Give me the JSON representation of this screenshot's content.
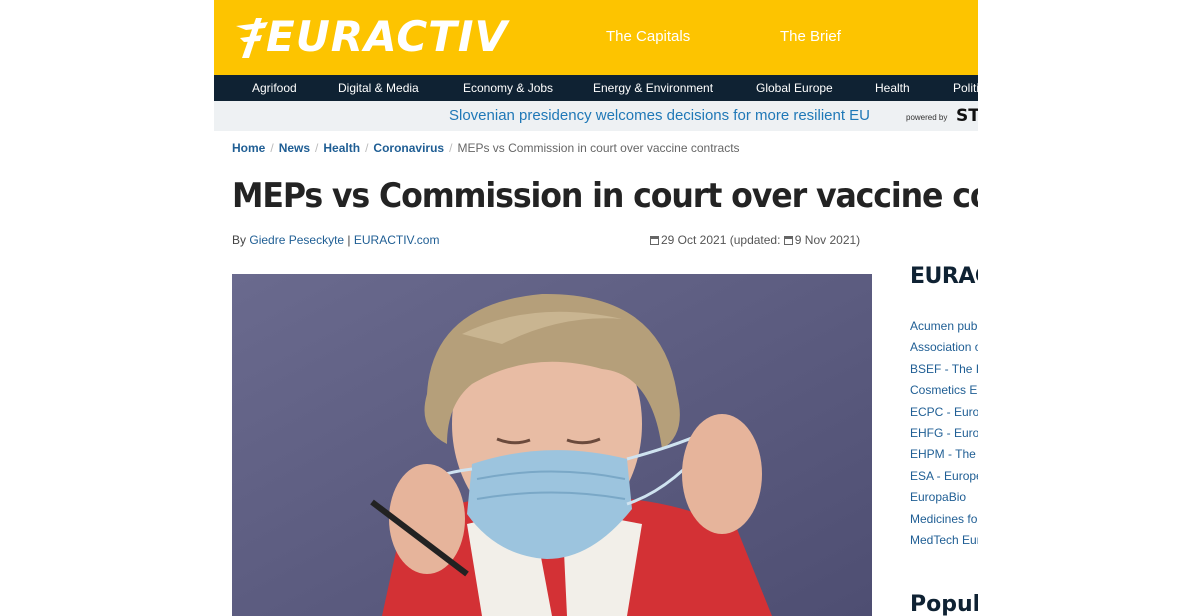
{
  "header": {
    "logo_text": "EURACTIV",
    "links": [
      "The Capitals",
      "The Brief"
    ]
  },
  "nav": {
    "items": [
      "Agrifood",
      "Digital & Media",
      "Economy & Jobs",
      "Energy & Environment",
      "Global Europe",
      "Health",
      "Politics"
    ]
  },
  "ticker": {
    "text": "Slovenian presidency welcomes decisions for more resilient EU",
    "powered_label": "powered by",
    "brand": "STA"
  },
  "breadcrumb": {
    "items": [
      "Home",
      "News",
      "Health",
      "Coronavirus"
    ],
    "separator": "/",
    "current": "MEPs vs Commission in court over vaccine contracts"
  },
  "article": {
    "title": "MEPs vs Commission in court over vaccine contracts",
    "by_label": "By",
    "author": "Giedre Peseckyte",
    "byline_sep": "|",
    "source": "EURACTIV.com",
    "date": "29 Oct 2021",
    "updated_prefix": "(updated:",
    "updated_date": "9 Nov 2021)"
  },
  "sidebar": {
    "title": "EURACTIV",
    "items": [
      "Acumen public affairs",
      "Association of",
      "BSEF - The International",
      "Cosmetics Europe",
      "ECPC - European",
      "EHFG - European",
      "EHPM - The European",
      "ESA - European",
      "EuropaBio",
      "Medicines for Europe",
      "MedTech Europe"
    ],
    "popular_title": "Popular"
  },
  "colors": {
    "brand_yellow": "#fdc400",
    "nav_dark": "#0f2233",
    "link_blue": "#1f5e94",
    "ticker_blue": "#1f78b7"
  }
}
